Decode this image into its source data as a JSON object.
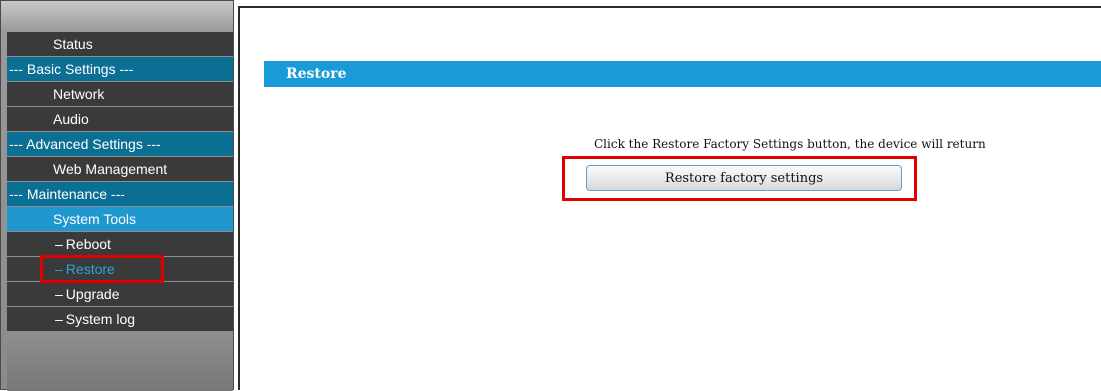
{
  "sidebar": {
    "items": [
      {
        "label": "Status"
      },
      {
        "label": "--- Basic Settings ---"
      },
      {
        "label": "Network"
      },
      {
        "label": "Audio"
      },
      {
        "label": "--- Advanced Settings ---"
      },
      {
        "label": "Web Management"
      },
      {
        "label": "--- Maintenance ---"
      },
      {
        "label": "System Tools"
      },
      {
        "label": "Reboot"
      },
      {
        "label": "Restore"
      },
      {
        "label": "Upgrade"
      },
      {
        "label": "System log"
      }
    ],
    "sub_prefix": "–"
  },
  "main": {
    "section_title": "Restore",
    "description": "Click the Restore Factory Settings button, the device will return",
    "restore_button_label": "Restore factory settings"
  },
  "colors": {
    "section_header": "#1a9bd7",
    "sidebar_section": "#0b6e93",
    "sidebar_active": "#1f97cf",
    "current_item_text": "#2ea3dc",
    "highlight": "#e00000"
  }
}
